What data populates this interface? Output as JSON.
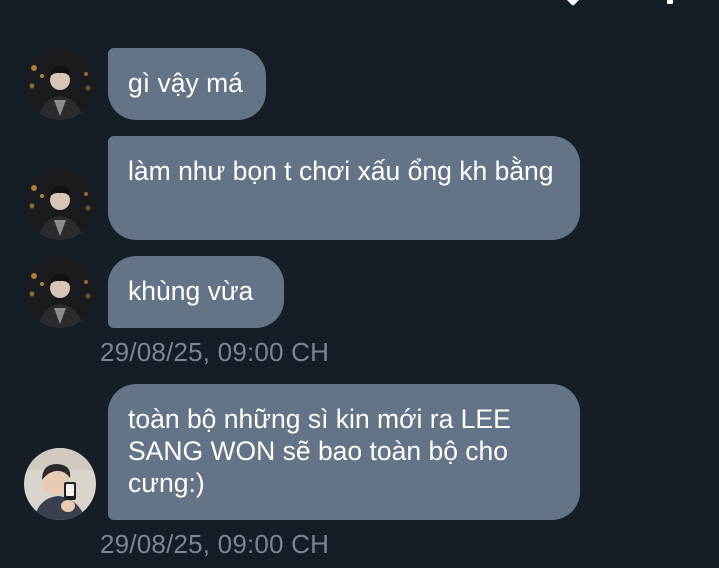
{
  "conversation": {
    "messages": [
      {
        "text": "gì vậy má",
        "sender": "contact-1"
      },
      {
        "text": "làm như bọn t chơi xấu ổng kh bằng",
        "sender": "contact-1"
      },
      {
        "text": "khùng vừa",
        "sender": "contact-1"
      },
      {
        "text": "toàn bộ những sì kin mới ra LEE SANG WON sẽ bao toàn bộ cho cưng:)",
        "sender": "contact-2"
      }
    ],
    "timestamps": [
      "29/08/25, 09:00 CH",
      "29/08/25, 09:00 CH"
    ]
  },
  "icons": {
    "top_left": "down-arrow-icon",
    "top_right": "more-icon"
  },
  "colors": {
    "background": "#151d27",
    "bubble": "#657386",
    "timestamp": "#7a8594",
    "text": "#ffffff"
  }
}
